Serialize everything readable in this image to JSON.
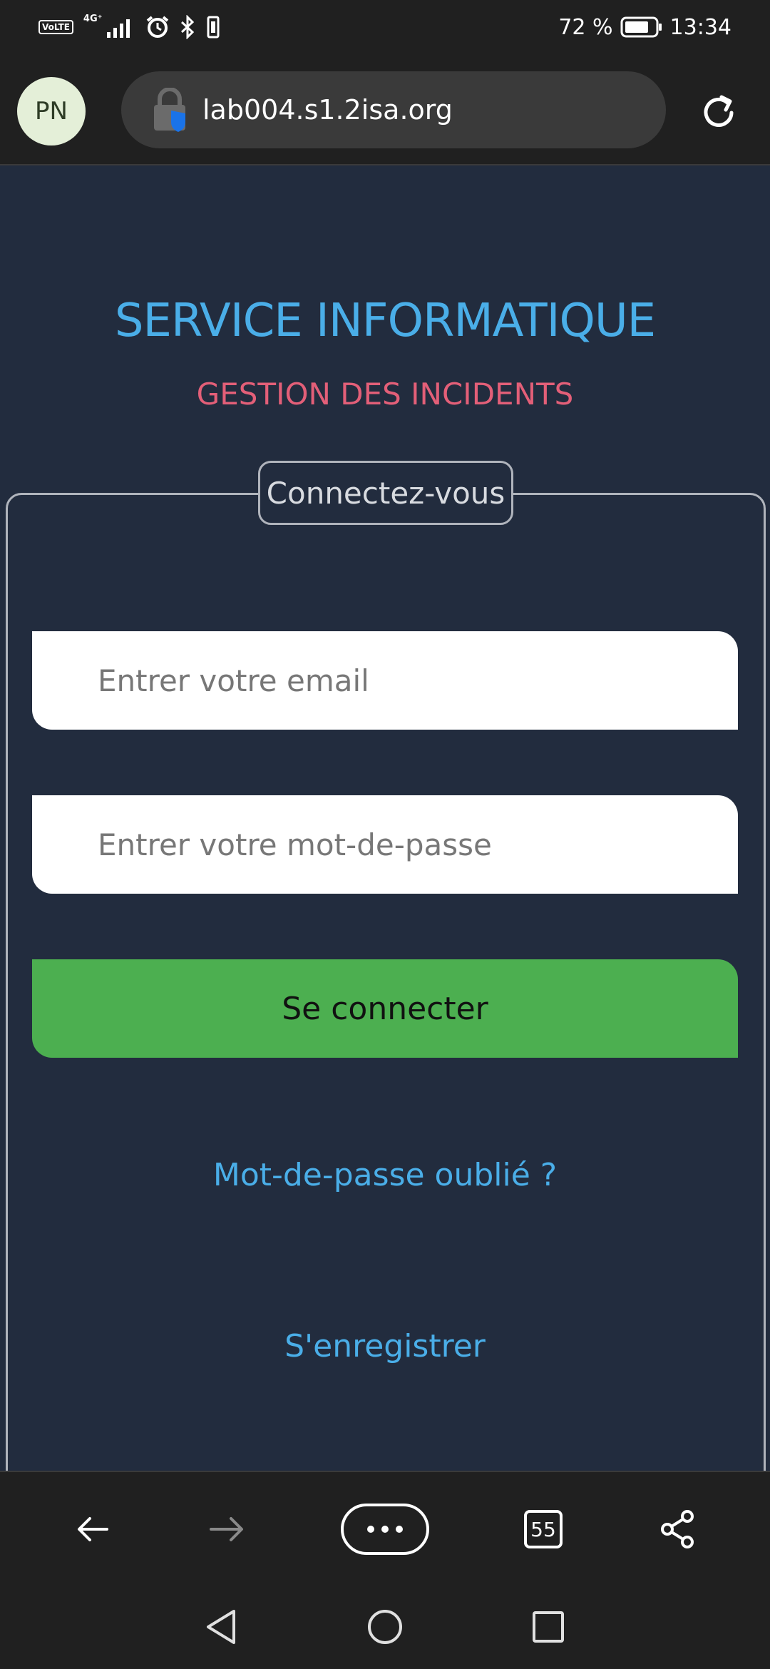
{
  "status_bar": {
    "volte": "VoLTE",
    "network_type": "4G⁺",
    "battery_percent": "72 %",
    "time": "13:34",
    "icons": [
      "volte-icon",
      "signal-icon",
      "alarm-icon",
      "bluetooth-icon",
      "vibrate-icon",
      "battery-icon"
    ]
  },
  "browser": {
    "profile_initials": "PN",
    "url": "lab004.s1.2isa.org",
    "icons": [
      "lock-shield-icon",
      "reload-icon"
    ]
  },
  "page": {
    "title": "SERVICE INFORMATIQUE",
    "subtitle": "GESTION DES INCIDENTS",
    "form": {
      "legend": "Connectez-vous",
      "email_placeholder": "Entrer votre email",
      "password_placeholder": "Entrer votre mot-de-passe",
      "submit_label": "Se connecter"
    },
    "links": {
      "forgot_password": "Mot-de-passe oublié ?",
      "register": "S'enregistrer"
    },
    "colors": {
      "background": "#222c3e",
      "title": "#4aaee8",
      "subtitle": "#e35f78",
      "button": "#4caf50"
    }
  },
  "bottom_bar": {
    "tab_count": "55",
    "icons": [
      "back-arrow-icon",
      "forward-arrow-icon",
      "more-icon",
      "tabs-icon",
      "share-icon"
    ]
  },
  "system_nav": {
    "icons": [
      "system-back-icon",
      "system-home-icon",
      "system-recents-icon"
    ]
  }
}
